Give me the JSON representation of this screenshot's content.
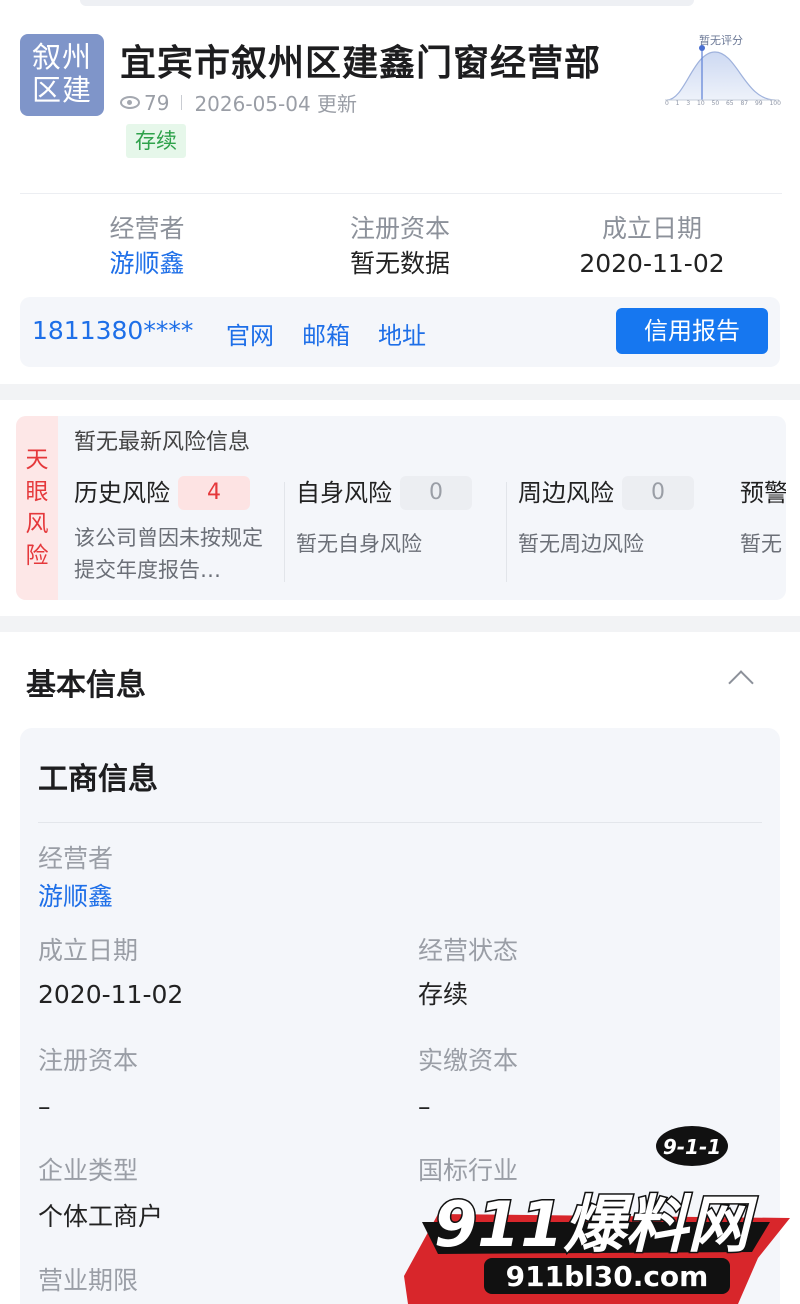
{
  "header": {
    "logo_lines": [
      "叙州",
      "区建"
    ],
    "company_name": "宜宾市叙州区建鑫门窗经营部",
    "views": "79",
    "update_date": "2026-05-04 更新",
    "status": "存续",
    "score_label": "暂无评分",
    "score_axis": [
      "0",
      "1",
      "3",
      "10",
      "50",
      "65",
      "87",
      "99",
      "100"
    ]
  },
  "stats": [
    {
      "label": "经营者",
      "value": "游顺鑫"
    },
    {
      "label": "注册资本",
      "value": "暂无数据"
    },
    {
      "label": "成立日期",
      "value": "2020-11-02"
    }
  ],
  "contact": {
    "phone": "1811380****",
    "website": "官网",
    "email": "邮箱",
    "address": "地址",
    "report_button": "信用报告"
  },
  "risk": {
    "side_label": [
      "天",
      "眼",
      "风",
      "险"
    ],
    "no_latest": "暂无最新风险信息",
    "columns": [
      {
        "title": "历史风险",
        "count": "4",
        "desc": "该公司曾因未按规定提交年度报告…"
      },
      {
        "title": "自身风险",
        "count": "0",
        "desc": "暂无自身风险"
      },
      {
        "title": "周边风险",
        "count": "0",
        "desc": "暂无周边风险"
      },
      {
        "title": "预警",
        "count": "",
        "desc": "暂无"
      }
    ]
  },
  "basic_info": {
    "section_title": "基本信息",
    "card_title": "工商信息",
    "fields": {
      "operator_label": "经营者",
      "operator_value": "游顺鑫",
      "founded_label": "成立日期",
      "founded_value": "2020-11-02",
      "status_label": "经营状态",
      "status_value": "存续",
      "reg_capital_label": "注册资本",
      "reg_capital_value": "–",
      "paid_capital_label": "实缴资本",
      "paid_capital_value": "–",
      "type_label": "企业类型",
      "type_value": "个体工商户",
      "industry_label": "国标行业",
      "term_label": "营业期限"
    }
  },
  "watermark": {
    "badge": "9-1-1",
    "brand": "911爆料网",
    "url": "911bl30.com"
  },
  "colors": {
    "accent": "#1677f0",
    "link": "#1e6fe8",
    "risk_red": "#e5383b",
    "status_green": "#2ea24b",
    "logo_bg": "#7f95c9"
  }
}
